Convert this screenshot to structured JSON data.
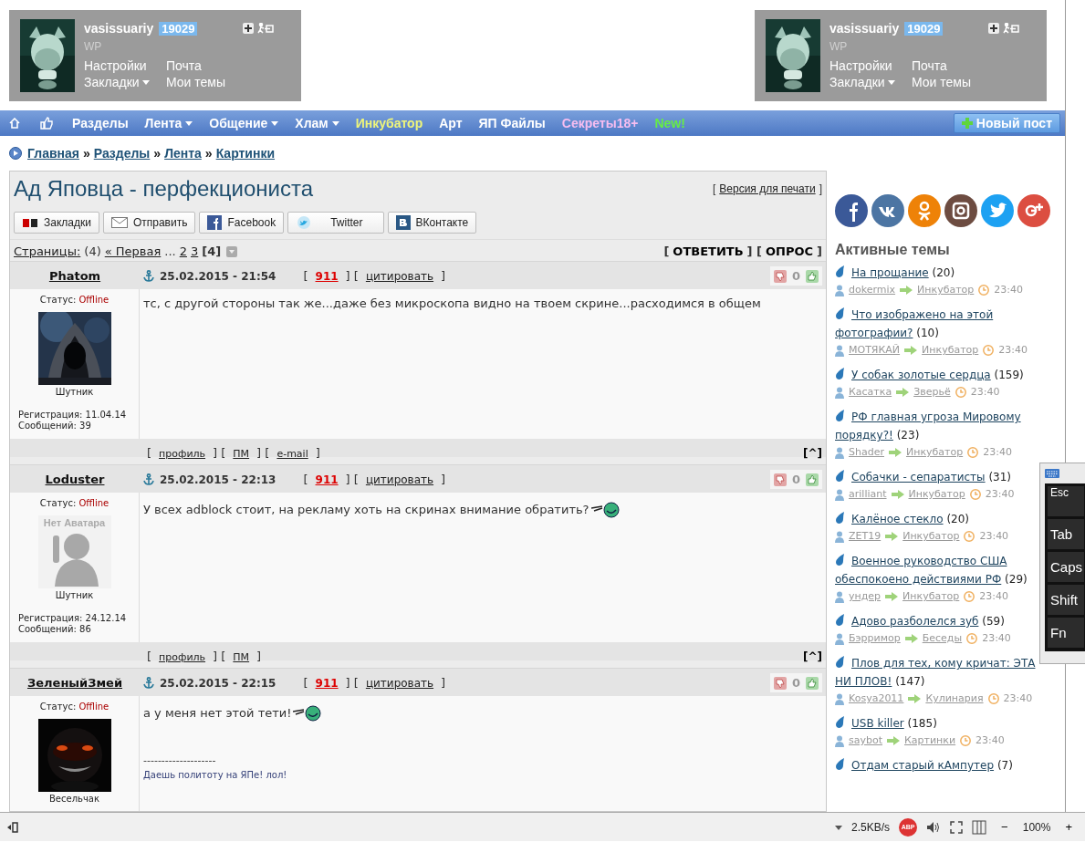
{
  "user_panels": [
    {
      "username": "vasissuariy",
      "points": "19029",
      "group": "WP",
      "links": [
        {
          "label": "Настройки",
          "dropdown": false
        },
        {
          "label": "Почта",
          "dropdown": false
        },
        {
          "label": "Закладки",
          "dropdown": true
        },
        {
          "label": "Мои темы",
          "dropdown": false
        }
      ]
    },
    {
      "username": "vasissuariy",
      "points": "19029",
      "group": "WP",
      "links": [
        {
          "label": "Настройки",
          "dropdown": false
        },
        {
          "label": "Почта",
          "dropdown": false
        },
        {
          "label": "Закладки",
          "dropdown": true
        },
        {
          "label": "Мои темы",
          "dropdown": false
        }
      ]
    }
  ],
  "nav": {
    "items": [
      {
        "label": "Разделы",
        "dropdown": false,
        "color": "#ffffff"
      },
      {
        "label": "Лента",
        "dropdown": true,
        "color": "#ffffff"
      },
      {
        "label": "Общение",
        "dropdown": true,
        "color": "#ffffff"
      },
      {
        "label": "Хлам",
        "dropdown": true,
        "color": "#ffffff"
      },
      {
        "label": "Инкубатор",
        "dropdown": false,
        "color": "#eef57a"
      },
      {
        "label": "Арт",
        "dropdown": false,
        "color": "#ffffff"
      },
      {
        "label": "ЯП Файлы",
        "dropdown": false,
        "color": "#ffffff"
      },
      {
        "label": "Секреты18+",
        "dropdown": false,
        "color": "#f7bdf0"
      },
      {
        "label": "New!",
        "dropdown": false,
        "color": "#66ee44"
      }
    ],
    "new_post": "Новый пост"
  },
  "breadcrumb": [
    {
      "text": "Главная",
      "kind": "link"
    },
    {
      "text": "»",
      "kind": "text"
    },
    {
      "text": "Разделы",
      "kind": "link"
    },
    {
      "text": "»",
      "kind": "text"
    },
    {
      "text": "Лента",
      "kind": "link"
    },
    {
      "text": "»",
      "kind": "text"
    },
    {
      "text": "Картинки",
      "kind": "link"
    }
  ],
  "topic": {
    "title": "Ад Яповца - перфекциониста",
    "print": [
      {
        "text": "[",
        "kind": "text"
      },
      {
        "text": "Версия для печати",
        "kind": "link"
      },
      {
        "text": "]",
        "kind": "text"
      }
    ],
    "share": [
      {
        "label": "Закладки",
        "kind": "yap"
      },
      {
        "label": "Отправить",
        "kind": "mail"
      },
      {
        "label": "Facebook",
        "kind": "facebook"
      },
      {
        "label": "Twitter",
        "kind": "twitter"
      },
      {
        "label": "ВКонтакте",
        "kind": "vk"
      }
    ],
    "pages": [
      {
        "text": "Страницы:",
        "kind": "link"
      },
      {
        "text": "(4)",
        "kind": "text"
      },
      {
        "text": "« Первая",
        "kind": "link"
      },
      {
        "text": "...",
        "kind": "text"
      },
      {
        "text": "2",
        "kind": "link"
      },
      {
        "text": "3",
        "kind": "link"
      },
      {
        "text": "[4]",
        "kind": "current"
      }
    ],
    "actions": [
      {
        "text": "[",
        "kind": "bold-text"
      },
      {
        "text": "ОТВЕТИТЬ",
        "kind": "bold-link"
      },
      {
        "text": "] [",
        "kind": "bold-text"
      },
      {
        "text": "ОПРОС",
        "kind": "bold-link"
      },
      {
        "text": "]",
        "kind": "bold-text"
      }
    ]
  },
  "posts": [
    {
      "author": "Phatom",
      "date": "25.02.2015 - 21:54",
      "meta": [
        {
          "text": "[",
          "kind": "text"
        },
        {
          "text": "911",
          "kind": "red-link"
        },
        {
          "text": "] [",
          "kind": "text"
        },
        {
          "text": "цитировать",
          "kind": "link"
        },
        {
          "text": "]",
          "kind": "text"
        }
      ],
      "rating": "0",
      "status_label": "Статус:",
      "status": "Offline",
      "avatar": {
        "kind": "picture"
      },
      "rank": "Шутник",
      "registration": "Регистрация: 11.04.14",
      "messages": "Сообщений: 39",
      "text": "тс, с другой стороны так же...даже без микроскопа видно на твоем скрине...расходимся в общем",
      "smiley": false,
      "footer": [
        {
          "text": "[",
          "kind": "text"
        },
        {
          "text": "профиль",
          "kind": "link"
        },
        {
          "text": "] [",
          "kind": "text"
        },
        {
          "text": "ПМ",
          "kind": "link"
        },
        {
          "text": "] [",
          "kind": "text"
        },
        {
          "text": "e-mail",
          "kind": "link"
        },
        {
          "text": "]",
          "kind": "text"
        }
      ],
      "top": "[^]"
    },
    {
      "author": "Loduster",
      "date": "25.02.2015 - 22:13",
      "meta": [
        {
          "text": "[",
          "kind": "text"
        },
        {
          "text": "911",
          "kind": "red-link"
        },
        {
          "text": "] [",
          "kind": "text"
        },
        {
          "text": "цитировать",
          "kind": "link"
        },
        {
          "text": "]",
          "kind": "text"
        }
      ],
      "rating": "0",
      "status_label": "Статус:",
      "status": "Offline",
      "avatar": {
        "kind": "placeholder",
        "text": "Нет Аватара"
      },
      "rank": "Шутник",
      "registration": "Регистрация: 24.12.14",
      "messages": "Сообщений: 86",
      "text": "У всех adblock стоит, на рекламу хоть на скринах внимание обратить?",
      "smiley": true,
      "footer": [
        {
          "text": "[",
          "kind": "text"
        },
        {
          "text": "профиль",
          "kind": "link"
        },
        {
          "text": "] [",
          "kind": "text"
        },
        {
          "text": "ПМ",
          "kind": "link"
        },
        {
          "text": "]",
          "kind": "text"
        }
      ],
      "top": "[^]"
    },
    {
      "author": "ЗеленыйЗмей",
      "date": "25.02.2015 - 22:15",
      "meta": [
        {
          "text": "[",
          "kind": "text"
        },
        {
          "text": "911",
          "kind": "red-link"
        },
        {
          "text": "] [",
          "kind": "text"
        },
        {
          "text": "цитировать",
          "kind": "link"
        },
        {
          "text": "]",
          "kind": "text"
        }
      ],
      "rating": "0",
      "status_label": "Статус:",
      "status": "Offline",
      "avatar": {
        "kind": "picture"
      },
      "rank": "Весельчак",
      "text": "а у меня нет этой тети!",
      "smiley": true,
      "signature_rule": "--------------------",
      "signature": "Даешь политоту на ЯПе! лол!"
    }
  ],
  "sidebar": {
    "social": [
      {
        "kind": "facebook",
        "color": "#3b5998"
      },
      {
        "kind": "vk",
        "color": "#4c75a3"
      },
      {
        "kind": "ok",
        "color": "#ee8208"
      },
      {
        "kind": "instagram",
        "color": "#6d4c41"
      },
      {
        "kind": "twitter",
        "color": "#1da1f2"
      },
      {
        "kind": "gplus",
        "color": "#dc4e41"
      }
    ],
    "title": "Активные темы",
    "topics": [
      {
        "title": "На прощание",
        "count": "(20)",
        "user": "dokermix",
        "section": "Инкубатор",
        "time": "23:40"
      },
      {
        "title": "Что изображено на этой фотографии?",
        "count": "(10)",
        "user": "МОТЯКАЙ",
        "section": "Инкубатор",
        "time": "23:40"
      },
      {
        "title": "У собак золотые сердца",
        "count": "(159)",
        "user": "Касатка",
        "section": "Зверьё",
        "time": "23:40"
      },
      {
        "title": "РФ главная угроза Мировому порядку?!",
        "count": "(23)",
        "user": "Shader",
        "section": "Инкубатор",
        "time": "23:40"
      },
      {
        "title": "Собачки - сепаратисты",
        "count": "(31)",
        "user": "arilliant",
        "section": "Инкубатор",
        "time": "23:40"
      },
      {
        "title": "Калёное стекло",
        "count": "(20)",
        "user": "ZET19",
        "section": "Инкубатор",
        "time": "23:40"
      },
      {
        "title": "Военное руководство США обеспокоено действиями РФ",
        "count": "(29)",
        "user": "ундер",
        "section": "Инкубатор",
        "time": "23:40"
      },
      {
        "title": "Адово разболелся зуб",
        "count": "(59)",
        "user": "Бэрримор",
        "section": "Беседы",
        "time": "23:40"
      },
      {
        "title": "Плов для тех, кому кричат: ЭТА НИ ПЛОВ!",
        "count": "(147)",
        "user": "Kosya2011",
        "section": "Кулинария",
        "time": "23:40"
      },
      {
        "title": "USB killer",
        "count": "(185)",
        "user": "saybot",
        "section": "Картинки",
        "time": "23:40"
      },
      {
        "title": "Отдам старый кАмпутер",
        "count": "(7)"
      }
    ]
  },
  "keyboard": {
    "keys": [
      "Esc",
      "Tab",
      "Caps",
      "Shift",
      "Fn"
    ]
  },
  "status_bar": {
    "speed": "2.5KB/s",
    "adblock": "ABP",
    "zoom_out": "−",
    "zoom": "100%",
    "zoom_in": "+"
  }
}
